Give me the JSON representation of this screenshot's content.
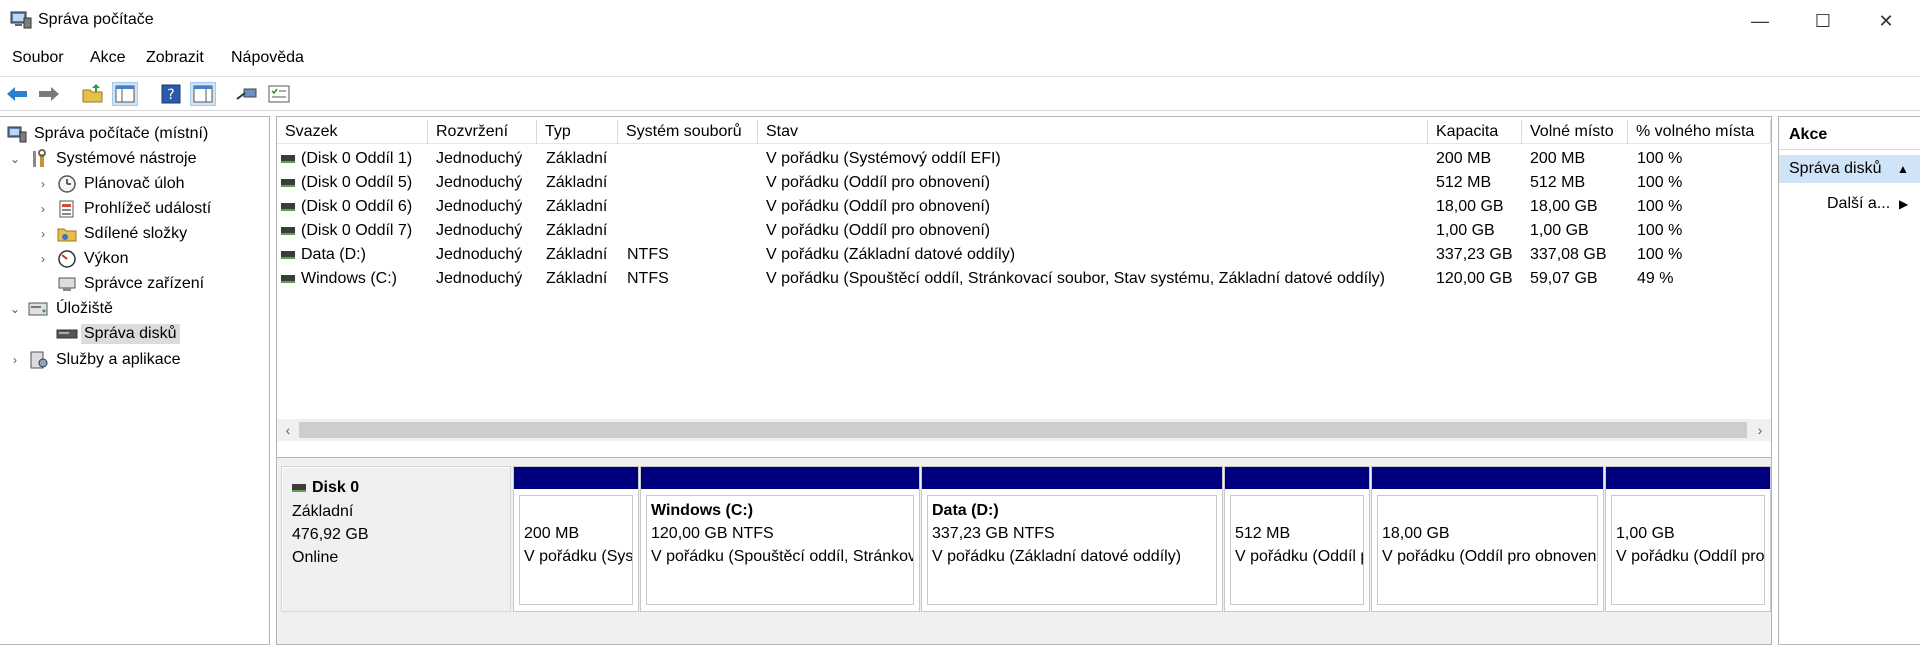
{
  "window": {
    "title": "Správa počítače",
    "min": "—",
    "max": "☐",
    "close": "✕"
  },
  "menu": [
    "Soubor",
    "Akce",
    "Zobrazit",
    "Nápověda"
  ],
  "tree": [
    {
      "label": "Správa počítače (místní)",
      "icon": "computer-management-icon",
      "arrow": ""
    },
    {
      "label": "Systémové nástroje",
      "icon": "tools-icon",
      "arrow": "⌄"
    },
    {
      "label": "Plánovač úloh",
      "icon": "clock-icon",
      "arrow": "›"
    },
    {
      "label": "Prohlížeč událostí",
      "icon": "event-viewer-icon",
      "arrow": "›"
    },
    {
      "label": "Sdílené složky",
      "icon": "shared-folder-icon",
      "arrow": "›"
    },
    {
      "label": "Výkon",
      "icon": "performance-icon",
      "arrow": "›"
    },
    {
      "label": "Správce zařízení",
      "icon": "device-manager-icon",
      "arrow": ""
    },
    {
      "label": "Úložiště",
      "icon": "storage-icon",
      "arrow": "⌄"
    },
    {
      "label": "Správa disků",
      "icon": "disk-icon",
      "arrow": ""
    },
    {
      "label": "Služby a aplikace",
      "icon": "services-icon",
      "arrow": "›"
    }
  ],
  "columns": [
    "Svazek",
    "Rozvržení",
    "Typ",
    "Systém souborů",
    "Stav",
    "Kapacita",
    "Volné místo",
    "% volného místa"
  ],
  "rows": [
    [
      "(Disk 0 Oddíl 1)",
      "Jednoduchý",
      "Základní",
      "",
      "V pořádku (Systémový oddíl EFI)",
      "200 MB",
      "200 MB",
      "100 %"
    ],
    [
      "(Disk 0 Oddíl 5)",
      "Jednoduchý",
      "Základní",
      "",
      "V pořádku (Oddíl pro obnovení)",
      "512 MB",
      "512 MB",
      "100 %"
    ],
    [
      "(Disk 0 Oddíl 6)",
      "Jednoduchý",
      "Základní",
      "",
      "V pořádku (Oddíl pro obnovení)",
      "18,00 GB",
      "18,00 GB",
      "100 %"
    ],
    [
      "(Disk 0 Oddíl 7)",
      "Jednoduchý",
      "Základní",
      "",
      "V pořádku (Oddíl pro obnovení)",
      "1,00 GB",
      "1,00 GB",
      "100 %"
    ],
    [
      "Data (D:)",
      "Jednoduchý",
      "Základní",
      "NTFS",
      "V pořádku (Základní datové oddíly)",
      "337,23 GB",
      "337,08 GB",
      "100 %"
    ],
    [
      "Windows (C:)",
      "Jednoduchý",
      "Základní",
      "NTFS",
      "V pořádku (Spouštěcí oddíl, Stránkovací soubor, Stav systému, Základní datové oddíly)",
      "120,00 GB",
      "59,07 GB",
      "49 %"
    ]
  ],
  "disk": {
    "name": "Disk 0",
    "type": "Základní",
    "size": "476,92 GB",
    "status": "Online",
    "partitions": [
      {
        "name": "",
        "size": "200 MB",
        "status": "V pořádku (Systémový oddíl EFI)"
      },
      {
        "name": "Windows  (C:)",
        "size": "120,00 GB NTFS",
        "status": "V pořádku (Spouštěcí oddíl, Stránkovací soubor)"
      },
      {
        "name": "Data  (D:)",
        "size": "337,23 GB NTFS",
        "status": "V pořádku (Základní datové oddíly)"
      },
      {
        "name": "",
        "size": "512 MB",
        "status": "V pořádku (Oddíl pro obnovení)"
      },
      {
        "name": "",
        "size": "18,00 GB",
        "status": "V pořádku (Oddíl pro obnovení)"
      },
      {
        "name": "",
        "size": "1,00 GB",
        "status": "V pořádku (Oddíl pro obnovení)"
      }
    ]
  },
  "actions": {
    "header": "Akce",
    "section": "Správa disků",
    "more": "Další a..."
  },
  "scroll": {
    "left": "‹",
    "right": "›"
  },
  "colors": {
    "partition_bar": "#00007f",
    "selected": "#cfe4f7"
  }
}
